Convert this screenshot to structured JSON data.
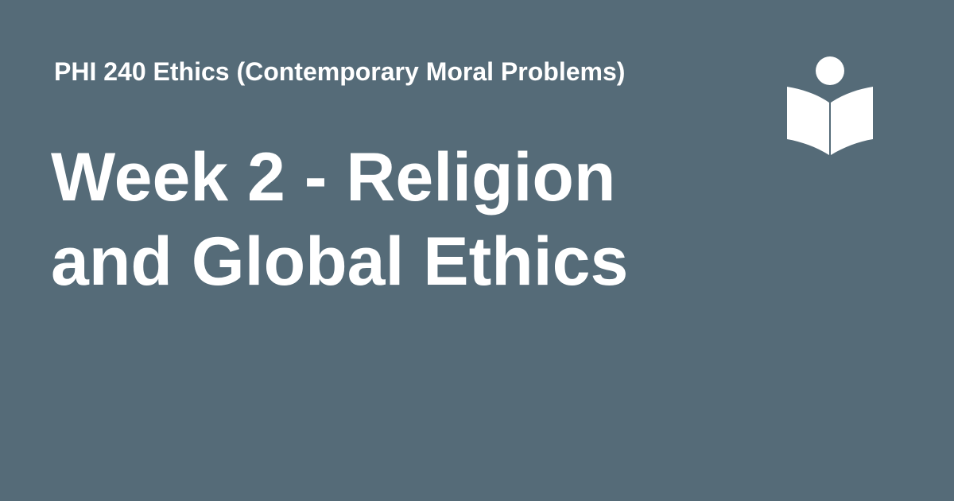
{
  "colors": {
    "background": "#556B78",
    "text": "#FFFFFF"
  },
  "course": {
    "title": "PHI 240 Ethics (Contemporary Moral Problems)"
  },
  "page": {
    "title": "Week 2 - Religion and Global Ethics"
  },
  "logo": {
    "icon": "person-reading-book-icon"
  }
}
